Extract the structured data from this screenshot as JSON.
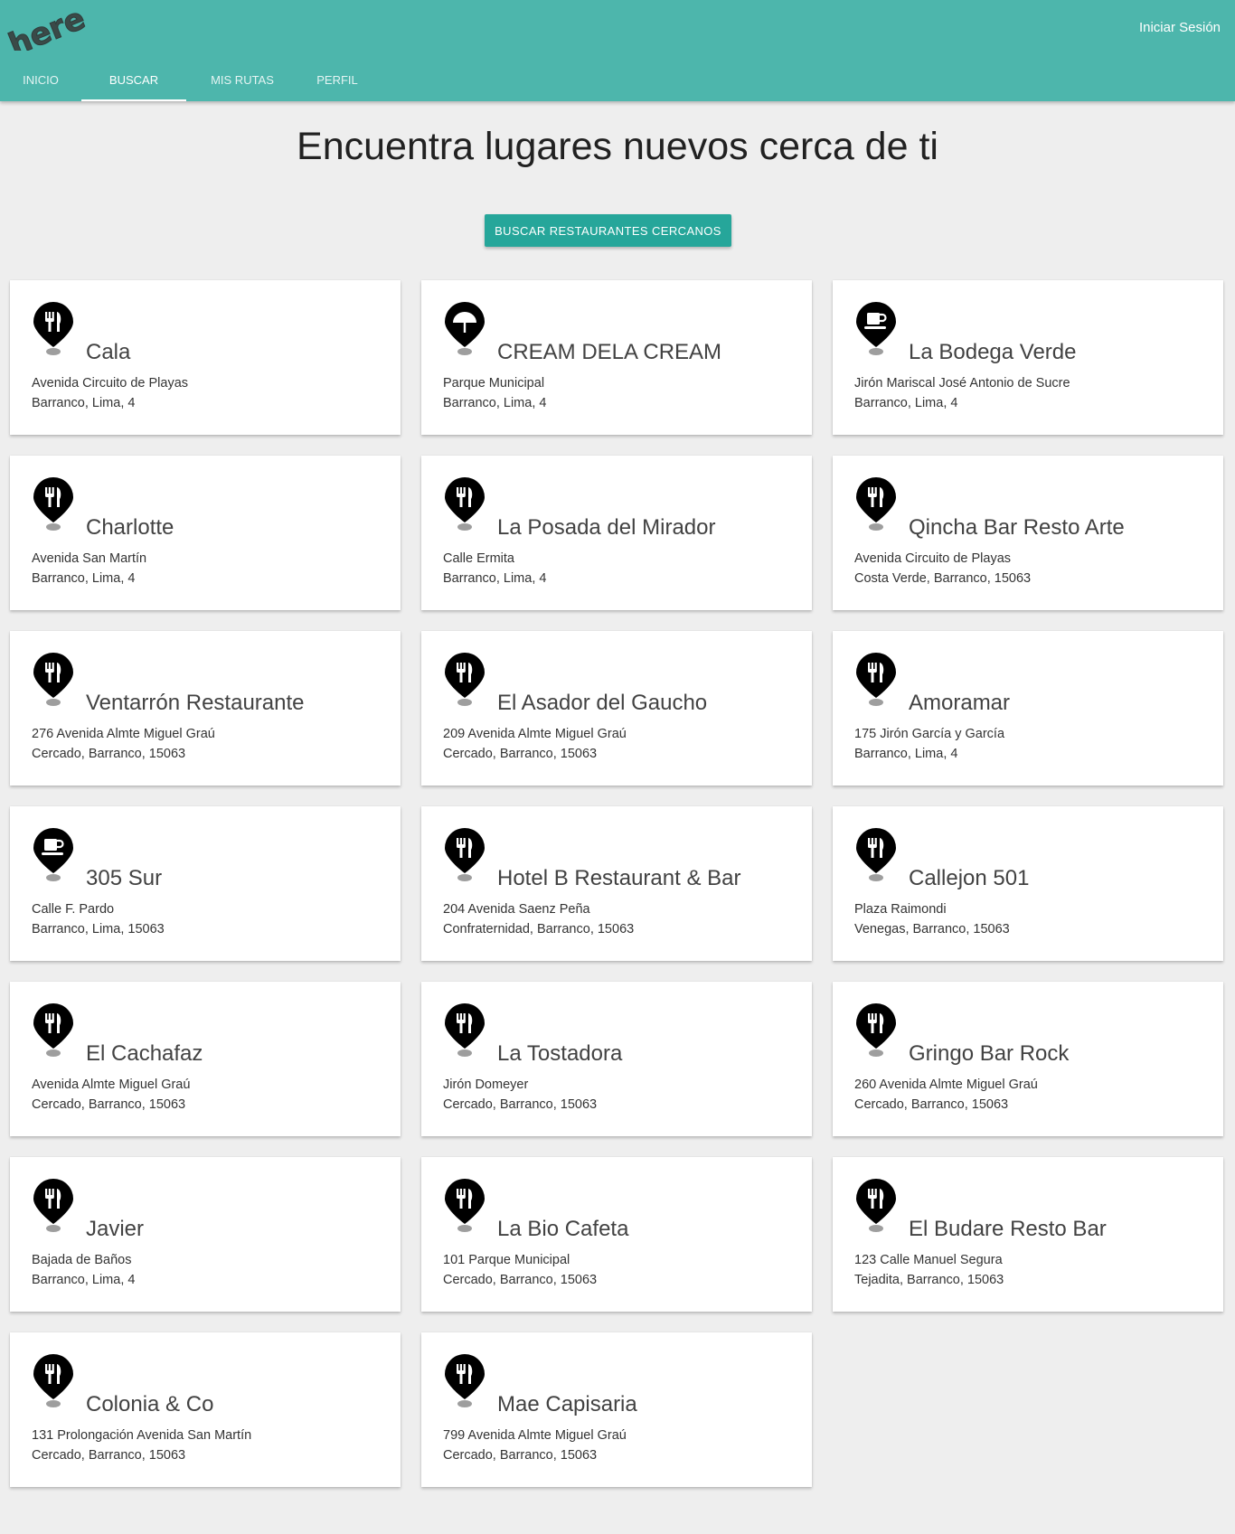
{
  "header": {
    "logo_text": "here",
    "login_label": "Iniciar Sesión",
    "tabs": [
      {
        "label": "INICIO",
        "active": false
      },
      {
        "label": "BUSCAR",
        "active": true
      },
      {
        "label": "MIS RUTAS",
        "active": false
      },
      {
        "label": "PERFIL",
        "active": false
      }
    ]
  },
  "main": {
    "title": "Encuentra lugares nuevos cerca de ti",
    "search_button_label": "BUSCAR RESTAURANTES CERCANOS"
  },
  "colors": {
    "header_bg": "#4db6ac",
    "button_bg": "#26a69a",
    "page_bg": "#eeeeee"
  },
  "places": [
    {
      "name": "Cala",
      "line1": "Avenida Circuito de Playas",
      "line2": "Barranco, Lima, 4",
      "icon": "restaurant-icon"
    },
    {
      "name": "CREAM DELA CREAM",
      "line1": "Parque Municipal",
      "line2": "Barranco, Lima, 4",
      "icon": "umbrella-icon"
    },
    {
      "name": "La Bodega Verde",
      "line1": "Jirón Mariscal José Antonio de Sucre",
      "line2": "Barranco, Lima, 4",
      "icon": "coffee-icon"
    },
    {
      "name": "Charlotte",
      "line1": "Avenida San Martín",
      "line2": "Barranco, Lima, 4",
      "icon": "restaurant-icon"
    },
    {
      "name": "La Posada del Mirador",
      "line1": "Calle Ermita",
      "line2": "Barranco, Lima, 4",
      "icon": "restaurant-icon"
    },
    {
      "name": "Qincha Bar Resto Arte",
      "line1": "Avenida Circuito de Playas",
      "line2": "Costa Verde, Barranco, 15063",
      "icon": "restaurant-icon"
    },
    {
      "name": "Ventarrón Restaurante",
      "line1": "276 Avenida Almte Miguel Graú",
      "line2": "Cercado, Barranco, 15063",
      "icon": "restaurant-icon"
    },
    {
      "name": "El Asador del Gaucho",
      "line1": "209 Avenida Almte Miguel Graú",
      "line2": "Cercado, Barranco, 15063",
      "icon": "restaurant-icon"
    },
    {
      "name": "Amoramar",
      "line1": "175 Jirón García y García",
      "line2": "Barranco, Lima, 4",
      "icon": "restaurant-icon"
    },
    {
      "name": "305 Sur",
      "line1": "Calle F. Pardo",
      "line2": "Barranco, Lima, 15063",
      "icon": "coffee-icon"
    },
    {
      "name": "Hotel B Restaurant & Bar",
      "line1": "204 Avenida Saenz Peña",
      "line2": "Confraternidad, Barranco, 15063",
      "icon": "restaurant-icon"
    },
    {
      "name": "Callejon 501",
      "line1": "Plaza Raimondi",
      "line2": "Venegas, Barranco, 15063",
      "icon": "restaurant-icon"
    },
    {
      "name": "El Cachafaz",
      "line1": "Avenida Almte Miguel Graú",
      "line2": "Cercado, Barranco, 15063",
      "icon": "restaurant-icon"
    },
    {
      "name": "La Tostadora",
      "line1": "Jirón Domeyer",
      "line2": "Cercado, Barranco, 15063",
      "icon": "restaurant-icon"
    },
    {
      "name": "Gringo Bar Rock",
      "line1": "260 Avenida Almte Miguel Graú",
      "line2": "Cercado, Barranco, 15063",
      "icon": "restaurant-icon"
    },
    {
      "name": "Javier",
      "line1": "Bajada de Baños",
      "line2": "Barranco, Lima, 4",
      "icon": "restaurant-icon"
    },
    {
      "name": "La Bio Cafeta",
      "line1": "101 Parque Municipal",
      "line2": "Cercado, Barranco, 15063",
      "icon": "restaurant-icon"
    },
    {
      "name": "El Budare Resto Bar",
      "line1": "123 Calle Manuel Segura",
      "line2": "Tejadita, Barranco, 15063",
      "icon": "restaurant-icon"
    },
    {
      "name": "Colonia & Co",
      "line1": "131 Prolongación Avenida San Martín",
      "line2": "Cercado, Barranco, 15063",
      "icon": "restaurant-icon"
    },
    {
      "name": "Mae Capisaria",
      "line1": "799 Avenida Almte Miguel Graú",
      "line2": "Cercado, Barranco, 15063",
      "icon": "restaurant-icon"
    }
  ]
}
